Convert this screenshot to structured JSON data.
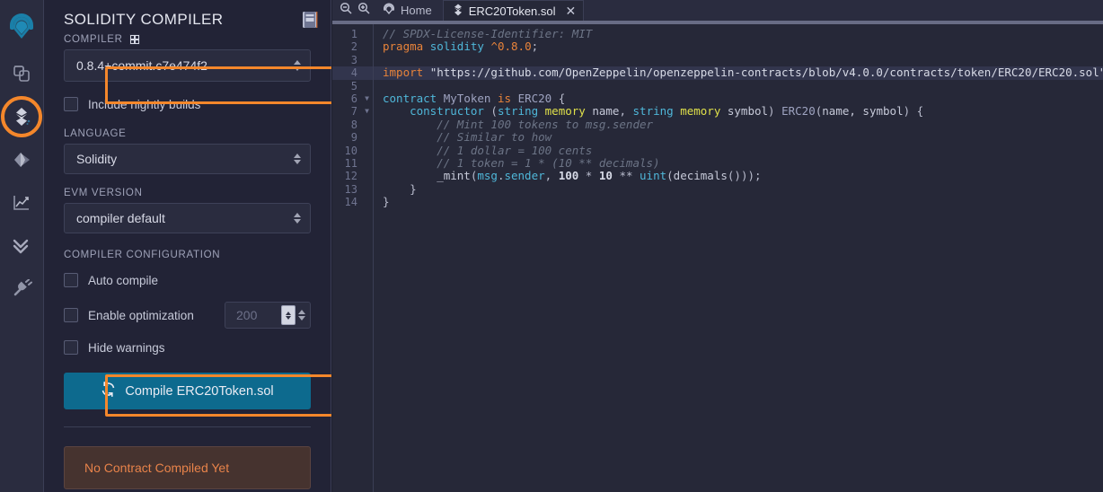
{
  "theme": {
    "accent_orange": "#f4872b",
    "panel_bg": "#222336",
    "editor_bg": "#262838",
    "button_blue": "#0d6a8e",
    "status_text": "#e8834a"
  },
  "icon_rail": {
    "items": [
      {
        "name": "remix-logo-icon",
        "label": "Remix"
      },
      {
        "name": "file-explorer-icon",
        "label": "File explorers"
      },
      {
        "name": "solidity-compiler-icon",
        "label": "Solidity compiler",
        "active": true
      },
      {
        "name": "deploy-run-icon",
        "label": "Deploy & run transactions"
      },
      {
        "name": "analysis-chart-icon",
        "label": "Solidity analysis"
      },
      {
        "name": "debugger-checks-icon",
        "label": "Debugger"
      },
      {
        "name": "plugin-manager-icon",
        "label": "Plugin manager"
      }
    ]
  },
  "panel": {
    "title": "SOLIDITY COMPILER",
    "doc_icon": "book-icon",
    "compiler_label": "COMPILER",
    "compiler_add_icon": "plus-square-icon",
    "compiler_version": "0.8.4+commit.c7e474f2",
    "nightly_label": "Include nightly builds",
    "nightly_checked": false,
    "language_label": "LANGUAGE",
    "language_value": "Solidity",
    "evm_label": "EVM VERSION",
    "evm_value": "compiler default",
    "config_label": "COMPILER CONFIGURATION",
    "auto_compile_label": "Auto compile",
    "auto_compile_checked": false,
    "optimization_label": "Enable optimization",
    "optimization_checked": false,
    "optimization_runs": "200",
    "hide_warnings_label": "Hide warnings",
    "hide_warnings_checked": false,
    "compile_icon": "refresh-icon",
    "compile_label": "Compile ERC20Token.sol",
    "status_message": "No Contract Compiled Yet"
  },
  "editor": {
    "zoom_out_icon": "zoom-out-icon",
    "zoom_in_icon": "zoom-in-icon",
    "home_icon": "remix-logo-icon",
    "home_label": "Home",
    "tab_icon": "solidity-file-icon",
    "tab_label": "ERC20Token.sol",
    "tab_close_icon": "close-icon",
    "active_line": 4,
    "fold_lines": [
      6,
      7
    ],
    "lines": [
      {
        "n": 1,
        "tokens": [
          {
            "c": "t-com",
            "t": "// SPDX-License-Identifier: MIT"
          }
        ]
      },
      {
        "n": 2,
        "tokens": [
          {
            "c": "t-key",
            "t": "pragma"
          },
          {
            "c": "t-def",
            "t": " "
          },
          {
            "c": "t-key2",
            "t": "solidity"
          },
          {
            "c": "t-def",
            "t": " "
          },
          {
            "c": "t-key",
            "t": "^0.8.0"
          },
          {
            "c": "t-punc",
            "t": ";"
          }
        ]
      },
      {
        "n": 3,
        "tokens": []
      },
      {
        "n": 4,
        "tokens": [
          {
            "c": "t-key",
            "t": "import"
          },
          {
            "c": "t-def",
            "t": " "
          },
          {
            "c": "t-str",
            "t": "\"https://github.com/OpenZeppelin/openzeppelin-contracts/blob/v4.0.0/contracts/token/ERC20/ERC20.sol\""
          },
          {
            "c": "t-punc",
            "t": ";"
          }
        ]
      },
      {
        "n": 5,
        "tokens": []
      },
      {
        "n": 6,
        "tokens": [
          {
            "c": "t-key2",
            "t": "contract"
          },
          {
            "c": "t-def",
            "t": " "
          },
          {
            "c": "t-cls",
            "t": "MyToken"
          },
          {
            "c": "t-def",
            "t": " "
          },
          {
            "c": "t-key",
            "t": "is"
          },
          {
            "c": "t-def",
            "t": " "
          },
          {
            "c": "t-cls",
            "t": "ERC20"
          },
          {
            "c": "t-punc",
            "t": " {"
          }
        ]
      },
      {
        "n": 7,
        "tokens": [
          {
            "c": "t-def",
            "t": "    "
          },
          {
            "c": "t-key2",
            "t": "constructor"
          },
          {
            "c": "t-punc",
            "t": " ("
          },
          {
            "c": "t-key2",
            "t": "string"
          },
          {
            "c": "t-def",
            "t": " "
          },
          {
            "c": "t-mem",
            "t": "memory"
          },
          {
            "c": "t-def",
            "t": " name"
          },
          {
            "c": "t-punc",
            "t": ", "
          },
          {
            "c": "t-key2",
            "t": "string"
          },
          {
            "c": "t-def",
            "t": " "
          },
          {
            "c": "t-mem",
            "t": "memory"
          },
          {
            "c": "t-def",
            "t": " symbol"
          },
          {
            "c": "t-punc",
            "t": ") "
          },
          {
            "c": "t-cls",
            "t": "ERC20"
          },
          {
            "c": "t-punc",
            "t": "("
          },
          {
            "c": "t-def",
            "t": "name, symbol"
          },
          {
            "c": "t-punc",
            "t": ") {"
          }
        ]
      },
      {
        "n": 8,
        "tokens": [
          {
            "c": "t-def",
            "t": "        "
          },
          {
            "c": "t-com",
            "t": "// Mint 100 tokens to msg.sender"
          }
        ]
      },
      {
        "n": 9,
        "tokens": [
          {
            "c": "t-def",
            "t": "        "
          },
          {
            "c": "t-com",
            "t": "// Similar to how"
          }
        ]
      },
      {
        "n": 10,
        "tokens": [
          {
            "c": "t-def",
            "t": "        "
          },
          {
            "c": "t-com",
            "t": "// 1 dollar = 100 cents"
          }
        ]
      },
      {
        "n": 11,
        "tokens": [
          {
            "c": "t-def",
            "t": "        "
          },
          {
            "c": "t-com",
            "t": "// 1 token = 1 * (10 ** decimals)"
          }
        ]
      },
      {
        "n": 12,
        "tokens": [
          {
            "c": "t-def",
            "t": "        _mint"
          },
          {
            "c": "t-punc",
            "t": "("
          },
          {
            "c": "t-key2",
            "t": "msg"
          },
          {
            "c": "t-punc",
            "t": "."
          },
          {
            "c": "t-key2",
            "t": "sender"
          },
          {
            "c": "t-punc",
            "t": ", "
          },
          {
            "c": "t-num",
            "t": "100"
          },
          {
            "c": "t-punc",
            "t": " * "
          },
          {
            "c": "t-num",
            "t": "10"
          },
          {
            "c": "t-punc",
            "t": " ** "
          },
          {
            "c": "t-key2",
            "t": "uint"
          },
          {
            "c": "t-punc",
            "t": "("
          },
          {
            "c": "t-def",
            "t": "decimals"
          },
          {
            "c": "t-punc",
            "t": "()));"
          }
        ]
      },
      {
        "n": 13,
        "tokens": [
          {
            "c": "t-def",
            "t": "    "
          },
          {
            "c": "t-punc",
            "t": "}"
          }
        ]
      },
      {
        "n": 14,
        "tokens": [
          {
            "c": "t-punc",
            "t": "}"
          }
        ]
      }
    ]
  }
}
